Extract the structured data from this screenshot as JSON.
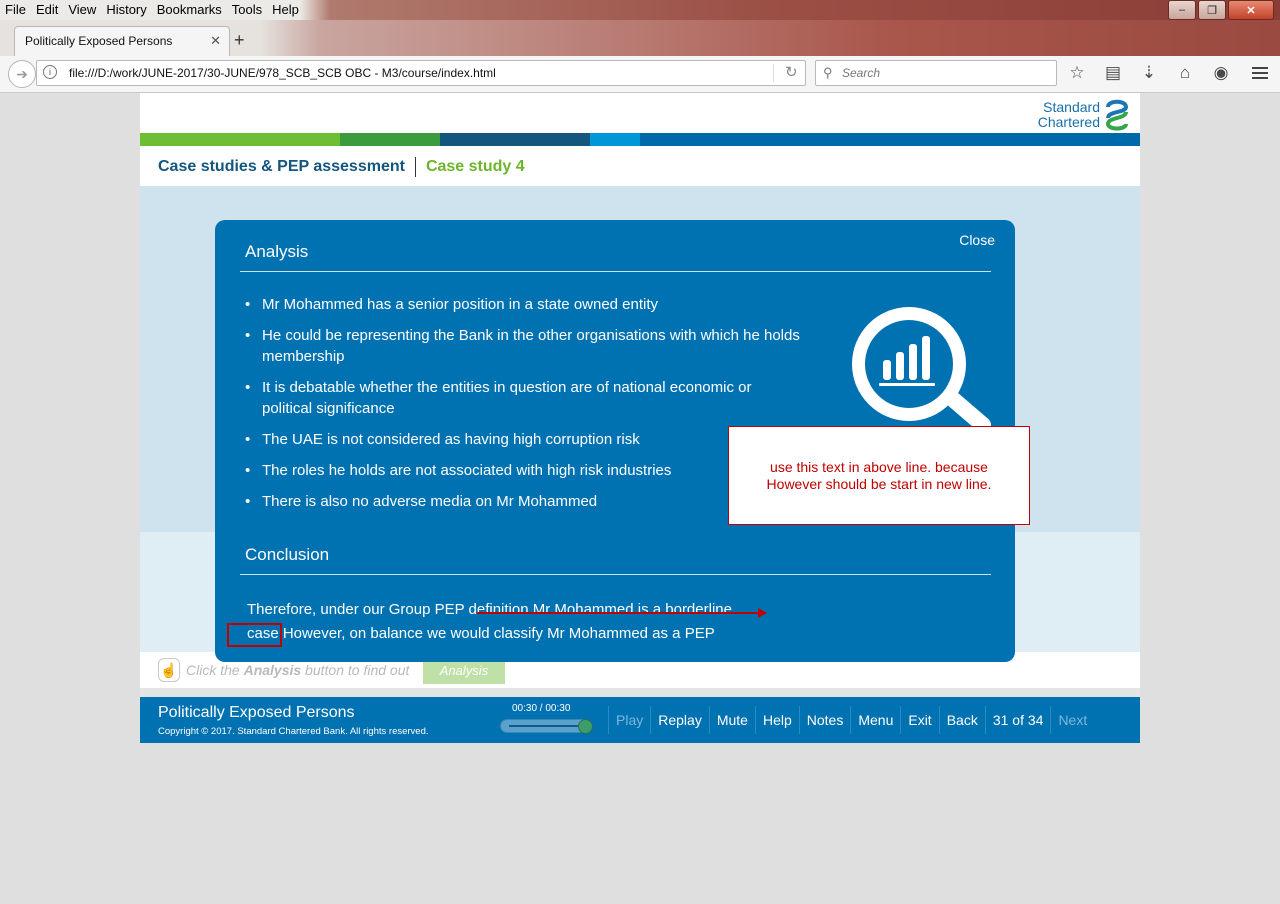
{
  "browser": {
    "menu": [
      "File",
      "Edit",
      "View",
      "History",
      "Bookmarks",
      "Tools",
      "Help"
    ],
    "tab_title": "Politically Exposed Persons",
    "new_tab": "+",
    "url": "file:///D:/work/JUNE-2017/30-JUNE/978_SCB_SCB OBC - M3/course/index.html",
    "search_placeholder": "Search"
  },
  "course": {
    "logo_line1": "Standard",
    "logo_line2": "Chartered",
    "colorbar": [
      "#6ebe34",
      "#3a9c3c",
      "#15567e",
      "#0097d8",
      "#0069aa"
    ],
    "breadcrumb": "Case studies & PEP assessment",
    "section": "Case study 4",
    "instruction_pre": "Click the ",
    "instruction_bold": "Analysis",
    "instruction_post": " button to find out",
    "analysis_button": "Analysis"
  },
  "modal": {
    "close": "Close",
    "analysis_heading": "Analysis",
    "bullets": [
      "Mr Mohammed has a senior position in a state owned entity",
      "He could be representing the Bank in the other organisations with which he holds membership",
      "It is debatable whether the entities in question are of national economic or political significance",
      "The UAE is not considered as having high corruption risk",
      "The roles he holds are not associated with high risk industries",
      "There is also no adverse media on Mr Mohammed"
    ],
    "conclusion_heading": "Conclusion",
    "conclusion_line1": "Therefore, under our Group PEP definition Mr Mohammed is a borderline",
    "conclusion_line2": "case However, on balance we would classify Mr Mohammed as a PEP"
  },
  "annotation": {
    "note_line1": "use this text in above line. because",
    "note_line2": "However should be start in new line."
  },
  "footer": {
    "title": "Politically Exposed Persons",
    "copyright": "Copyright © 2017. Standard Chartered Bank. All rights reserved.",
    "time": "00:30 / 00:30",
    "progress_fraction": 1.0,
    "play": "Play",
    "replay": "Replay",
    "mute": "Mute",
    "help": "Help",
    "notes": "Notes",
    "menu": "Menu",
    "exit": "Exit",
    "back": "Back",
    "page": "31 of 34",
    "next": "Next"
  }
}
